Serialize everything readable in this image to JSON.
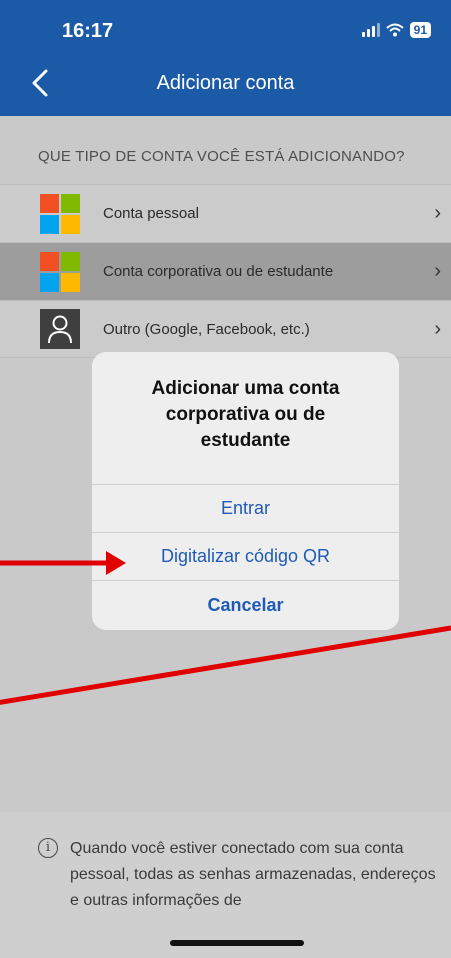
{
  "status_bar": {
    "time": "16:17",
    "battery": "91"
  },
  "nav": {
    "title": "Adicionar conta"
  },
  "section_header": "QUE TIPO DE CONTA VOCÊ ESTÁ ADICIONANDO?",
  "accounts": [
    {
      "label": "Conta pessoal",
      "icon": "microsoft-logo-icon"
    },
    {
      "label": "Conta corporativa ou de estudante",
      "icon": "microsoft-logo-icon"
    },
    {
      "label": "Outro (Google, Facebook, etc.)",
      "icon": "person-icon"
    }
  ],
  "dialog": {
    "title": "Adicionar uma conta corporativa ou de estudante",
    "sign_in": "Entrar",
    "scan_qr": "Digitalizar código QR",
    "cancel": "Cancelar"
  },
  "footer": {
    "info_text": "Quando você estiver conectado com sua conta pessoal, todas as senhas armazenadas, endereços e outras informações de"
  },
  "colors": {
    "brand_blue": "#1b5aa6",
    "link_blue": "#1f5bb6",
    "annotation_red": "#e00000",
    "ms_red": "#f25022",
    "ms_green": "#7fba00",
    "ms_blue": "#00a4ef",
    "ms_yellow": "#ffb900"
  }
}
